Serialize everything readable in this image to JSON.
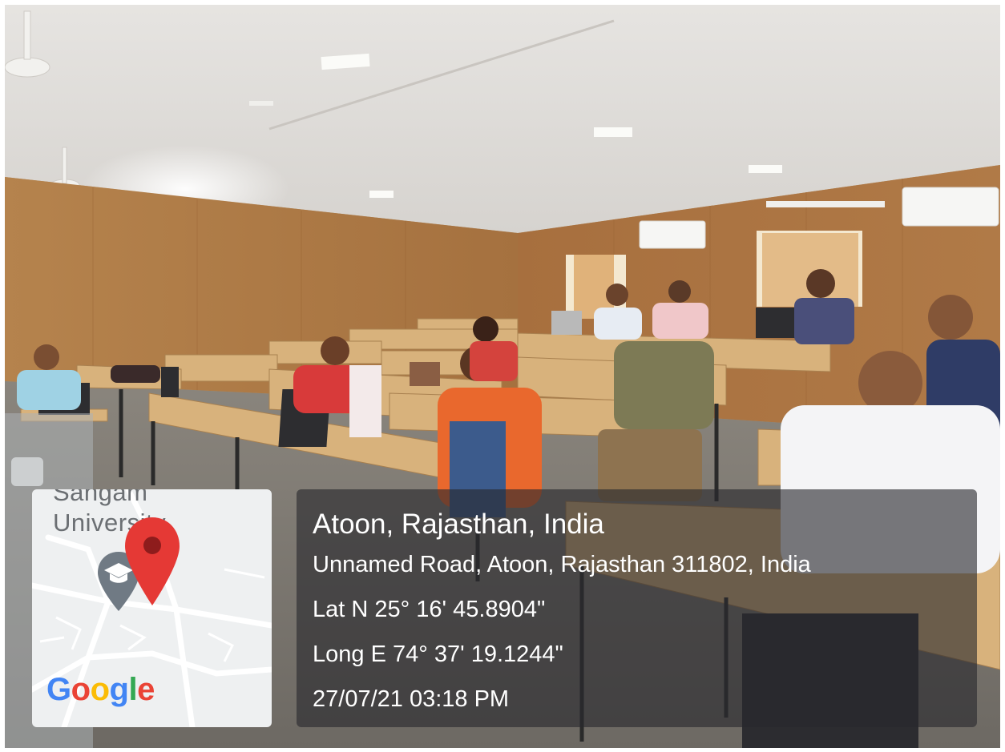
{
  "photo": {
    "scene": "classroom"
  },
  "map": {
    "label_top": "Sangam",
    "label_main": "University",
    "logo_letters": [
      {
        "ch": "G",
        "color": "#4285F4"
      },
      {
        "ch": "o",
        "color": "#EA4335"
      },
      {
        "ch": "o",
        "color": "#FBBC05"
      },
      {
        "ch": "g",
        "color": "#4285F4"
      },
      {
        "ch": "l",
        "color": "#34A853"
      },
      {
        "ch": "e",
        "color": "#EA4335"
      }
    ],
    "pin_color": "#E53935",
    "campus_icon": "graduation-cap-icon"
  },
  "location": {
    "place": "Atoon, Rajasthan, India",
    "address": "Unnamed Road, Atoon, Rajasthan 311802, India",
    "latitude": "Lat N 25° 16' 45.8904\"",
    "longitude": "Long E 74° 37' 19.1244\"",
    "timestamp": "27/07/21 03:18 PM"
  }
}
